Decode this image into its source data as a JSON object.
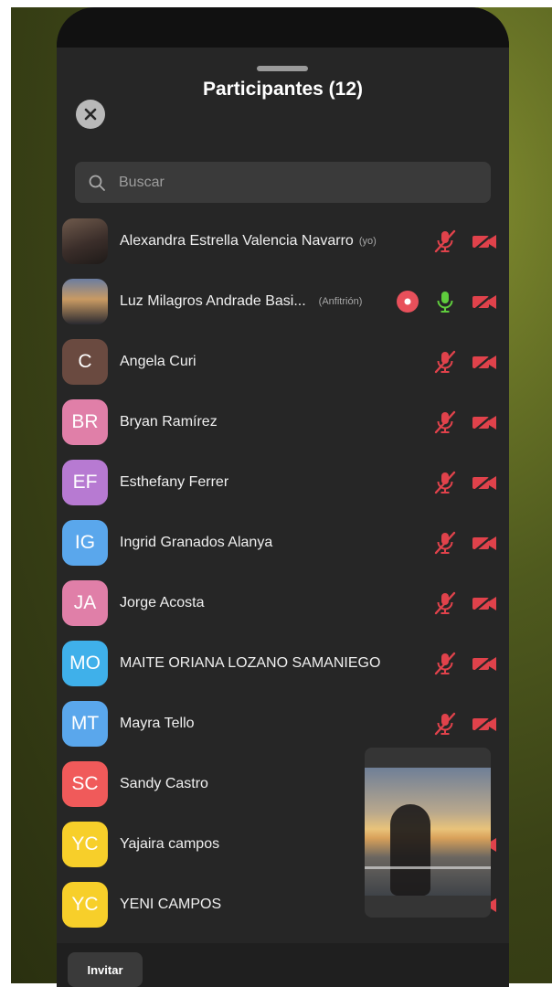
{
  "panel": {
    "title": "Participantes (12)"
  },
  "search": {
    "placeholder": "Buscar"
  },
  "colors": {
    "muted_red": "#e0424b",
    "live_green": "#5fcc3d",
    "record_red": "#e8505b"
  },
  "participants": [
    {
      "name": "Alexandra Estrella Valencia Navarro",
      "tag": "(yo)",
      "initials": "",
      "avatar_color": "#4a3a33",
      "mic": "muted",
      "camera": "off"
    },
    {
      "name": "Luz Milagros Andrade Basi...",
      "tag": "(Anfitrión)",
      "initials": "",
      "avatar_color": "#8a7a6a",
      "mic": "on",
      "camera": "off",
      "recording": true
    },
    {
      "name": "Angela Curi",
      "tag": "",
      "initials": "C",
      "avatar_color": "#6a4a40",
      "mic": "muted",
      "camera": "off"
    },
    {
      "name": "Bryan Ramírez",
      "tag": "",
      "initials": "BR",
      "avatar_color": "#e07fa8",
      "mic": "muted",
      "camera": "off"
    },
    {
      "name": "Esthefany Ferrer",
      "tag": "",
      "initials": "EF",
      "avatar_color": "#b77ad2",
      "mic": "muted",
      "camera": "off"
    },
    {
      "name": "Ingrid Granados Alanya",
      "tag": "",
      "initials": "IG",
      "avatar_color": "#5aa7ec",
      "mic": "muted",
      "camera": "off"
    },
    {
      "name": "Jorge Acosta",
      "tag": "",
      "initials": "JA",
      "avatar_color": "#e07fa8",
      "mic": "muted",
      "camera": "off"
    },
    {
      "name": "MAITE ORIANA LOZANO SAMANIEGO",
      "tag": "",
      "initials": "MO",
      "avatar_color": "#3fb0ea",
      "mic": "muted",
      "camera": "off"
    },
    {
      "name": "Mayra Tello",
      "tag": "",
      "initials": "MT",
      "avatar_color": "#5aa7ec",
      "mic": "muted",
      "camera": "off"
    },
    {
      "name": "Sandy Castro",
      "tag": "",
      "initials": "SC",
      "avatar_color": "#f05a5a",
      "mic": "",
      "camera": ""
    },
    {
      "name": "Yajaira campos",
      "tag": "",
      "initials": "YC",
      "avatar_color": "#f7cf2a",
      "mic": "",
      "camera": "off"
    },
    {
      "name": "YENI CAMPOS",
      "tag": "",
      "initials": "YC",
      "avatar_color": "#f7cf2a",
      "mic": "muted",
      "camera": "off"
    }
  ],
  "footer": {
    "invite_label": "Invitar"
  }
}
